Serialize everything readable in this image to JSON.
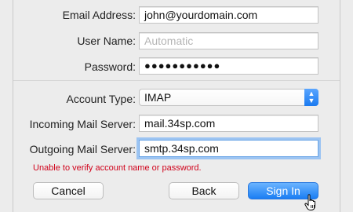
{
  "form": {
    "email_label": "Email Address:",
    "email_value": "john@yourdomain.com",
    "username_label": "User Name:",
    "username_placeholder": "Automatic",
    "password_label": "Password:",
    "password_value": "●●●●●●●●●●●",
    "account_type_label": "Account Type:",
    "account_type_value": "IMAP",
    "incoming_label": "Incoming Mail Server:",
    "incoming_value": "mail.34sp.com",
    "outgoing_label": "Outgoing Mail Server:",
    "outgoing_value": "smtp.34sp.com",
    "error_message": "Unable to verify account name or password."
  },
  "buttons": {
    "cancel": "Cancel",
    "back": "Back",
    "sign_in": "Sign In"
  },
  "icons": {
    "popup_arrows": "up-down-chevron-icon",
    "cursor": "hand-pointer-icon"
  },
  "colors": {
    "accent": "#1a7df3",
    "error": "#d0021b",
    "focus_ring": "#9cc4f2"
  }
}
